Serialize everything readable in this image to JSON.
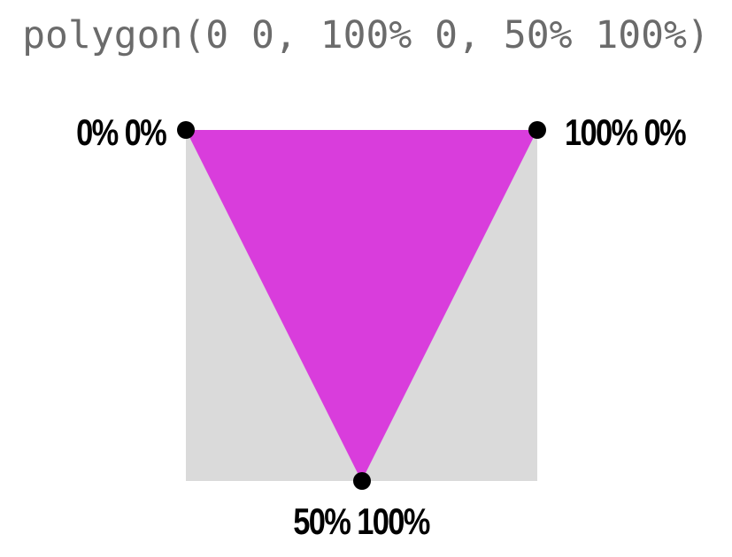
{
  "code": {
    "text": "polygon(0 0, 100% 0, 50% 100%)"
  },
  "shape": {
    "container_color": "#dadada",
    "fill_color": "#d93ddc",
    "points": [
      {
        "x": 0,
        "y": 0,
        "label": "0% 0%"
      },
      {
        "x": 1,
        "y": 0,
        "label": "100% 0%"
      },
      {
        "x": 0.5,
        "y": 1,
        "label": "50% 100%"
      }
    ]
  },
  "labels": {
    "top_left": "0% 0%",
    "top_right": "100% 0%",
    "bottom": "50% 100%"
  },
  "dot_color": "#000000"
}
